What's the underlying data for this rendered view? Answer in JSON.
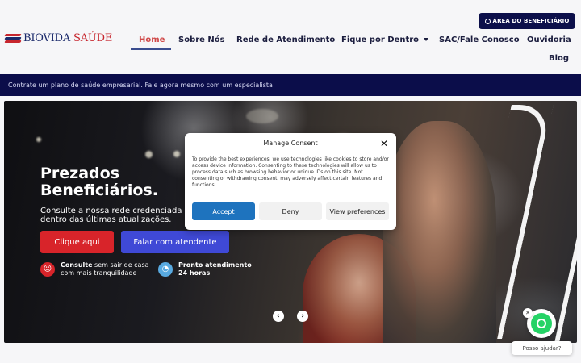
{
  "header": {
    "logo_prefix": "BIOVIDA",
    "logo_suffix": "SAÚDE",
    "area_button_label": "ÁREA DO BENEFICIÁRIO",
    "nav": [
      "Home",
      "Sobre Nós",
      "Rede de Atendimento",
      "Fique por Dentro",
      "SAC/Fale Conosco",
      "Ouvidoria",
      "Blog"
    ],
    "active_nav": "Home"
  },
  "banner": {
    "text": "Contrate um plano de saúde empresarial. Fale agora mesmo com um especialista!"
  },
  "hero": {
    "title_line1": "Prezados",
    "title_line2": "Beneficiários.",
    "subtitle_line1": "Consulte a nossa rede credenciada",
    "subtitle_line2": "dentro das últimas atualizações.",
    "primary_button": "Clique aqui",
    "secondary_button": "Falar com atendente",
    "features": [
      {
        "bold": "Consulte",
        "text1": " sem sair de casa",
        "text2": "com mais tranquilidade",
        "icon": "smile-icon",
        "color": "#d8242a"
      },
      {
        "bold": "Pronto atendimento",
        "text1": "",
        "text2": "24 horas",
        "icon": "clock-icon",
        "color": "#58a9e0"
      }
    ]
  },
  "consent": {
    "title": "Manage Consent",
    "body": "To provide the best experiences, we use technologies like cookies to store and/or access device information. Consenting to these technologies will allow us to process data such as browsing behavior or unique IDs on this site. Not consenting or withdrawing consent, may adversely affect certain features and functions.",
    "accept": "Accept",
    "deny": "Deny",
    "preferences": "View preferences"
  },
  "chat": {
    "help_label": "Posso ajudar?"
  },
  "colors": {
    "navy": "#0b0d4a",
    "red": "#d8242a",
    "blue": "#3f49d6",
    "accept_blue": "#1e73be",
    "whatsapp": "#25d366"
  }
}
